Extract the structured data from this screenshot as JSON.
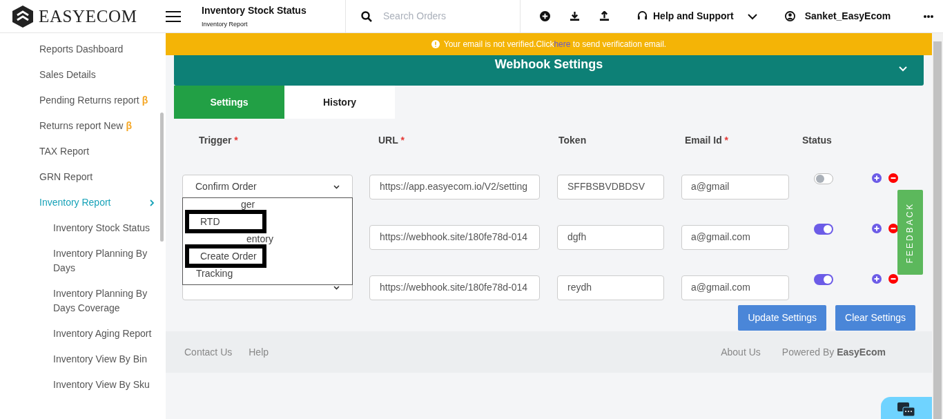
{
  "header": {
    "logo": "EASYECOM",
    "title": "Inventory Stock Status",
    "subtitle": "Inventory Report",
    "search": {
      "placeholder": "Search Orders"
    },
    "help": "Help and Support",
    "user": "Sanket_EasyEcom"
  },
  "sidebar": {
    "items": [
      {
        "label": "Reports Dashboard",
        "selected": false
      },
      {
        "label": "Sales Details",
        "selected": false
      },
      {
        "label": "Pending Returns report",
        "badge": "β",
        "selected": false
      },
      {
        "label": "Returns report New",
        "badge": "β",
        "selected": false
      },
      {
        "label": "TAX Report",
        "selected": false
      },
      {
        "label": "GRN Report",
        "selected": false
      },
      {
        "label": "Inventory Report",
        "selected": true,
        "expanded": true,
        "children": [
          {
            "label": "Inventory Stock Status",
            "selected": false
          },
          {
            "label": "Inventory Planning By Days",
            "selected": false
          },
          {
            "label": "Inventory Planning By Days Coverage",
            "selected": false
          },
          {
            "label": "Inventory Aging Report",
            "selected": false
          },
          {
            "label": "Inventory View By Bin",
            "selected": false
          },
          {
            "label": "Inventory View By Sku",
            "selected": false
          }
        ]
      }
    ]
  },
  "banner": {
    "before": "Your email is not verified.Click",
    "link": "here",
    "after": "to send verification email."
  },
  "panel": {
    "title": "Webhook Settings",
    "tabs": [
      {
        "label": "Settings",
        "selected": true
      },
      {
        "label": "History",
        "selected": false
      }
    ],
    "columns": [
      {
        "label": "Trigger",
        "mark": "*"
      },
      {
        "label": "URL",
        "mark": "*"
      },
      {
        "label": "Token"
      },
      {
        "label": "Email Id",
        "mark": "*"
      },
      {
        "label": "Status"
      }
    ],
    "rows": [
      {
        "trigger": "Confirm Order",
        "url": "https://app.easyecom.io/V2/setting",
        "token": "SFFBSBVDBDSV",
        "email": "a@gmail",
        "on": false
      },
      {
        "url": "https://webhook.site/180fe78d-014",
        "token": "dgfh",
        "email": "a@gmail.com",
        "on": true
      },
      {
        "url": "https://webhook.site/180fe78d-014",
        "token": "reydh",
        "email": "a@gmail.com",
        "on": true
      }
    ],
    "dropdown": [
      {
        "text": "ger",
        "kind": "partial"
      },
      {
        "text": "RTD",
        "kind": "boxed"
      },
      {
        "text": "entory",
        "kind": "partial"
      },
      {
        "text": "Create Order",
        "kind": "boxed"
      },
      {
        "text": "Tracking",
        "kind": "plain"
      }
    ],
    "buttons": [
      "Update Settings",
      "Clear Settings"
    ]
  },
  "footer": {
    "left": [
      "Contact Us",
      "Help"
    ],
    "about": "About Us",
    "powered": "Powered By",
    "brand": "EasyEcom"
  },
  "feedback": "FEEDBACK"
}
